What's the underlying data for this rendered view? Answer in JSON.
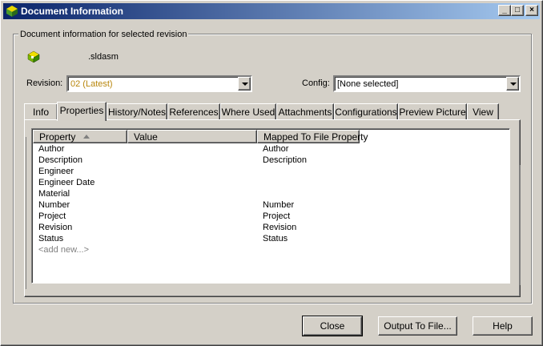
{
  "window": {
    "title": "Document Information",
    "buttons": {
      "minimize": "_",
      "maximize": "□",
      "close": "×"
    }
  },
  "group": {
    "legend": "Document information for selected revision"
  },
  "document": {
    "name": ".sldasm",
    "icon": "assembly-document-icon"
  },
  "revision": {
    "label": "Revision:",
    "value": "02 (Latest)",
    "value_color": "#b8860b"
  },
  "config": {
    "label": "Config:",
    "value": "[None selected]"
  },
  "tabs": [
    {
      "label": "Info"
    },
    {
      "label": "Properties"
    },
    {
      "label": "History/Notes"
    },
    {
      "label": "References"
    },
    {
      "label": "Where Used"
    },
    {
      "label": "Attachments"
    },
    {
      "label": "Configurations"
    },
    {
      "label": "Preview Picture"
    },
    {
      "label": "View"
    }
  ],
  "active_tab": "Properties",
  "properties_table": {
    "columns": [
      "Property",
      "Value",
      "Mapped To File Property"
    ],
    "rows": [
      {
        "property": "Author",
        "value": "",
        "mapped": "Author"
      },
      {
        "property": "Description",
        "value": "",
        "mapped": "Description"
      },
      {
        "property": "Engineer",
        "value": "",
        "mapped": ""
      },
      {
        "property": "Engineer Date",
        "value": "",
        "mapped": ""
      },
      {
        "property": "Material",
        "value": "",
        "mapped": ""
      },
      {
        "property": "Number",
        "value": "",
        "mapped": "Number"
      },
      {
        "property": "Project",
        "value": "",
        "mapped": "Project"
      },
      {
        "property": "Revision",
        "value": "",
        "mapped": "Revision"
      },
      {
        "property": "Status",
        "value": "",
        "mapped": "Status"
      }
    ],
    "add_new": "<add new...>"
  },
  "buttons": {
    "close": "Close",
    "output": "Output To File...",
    "help": "Help"
  }
}
